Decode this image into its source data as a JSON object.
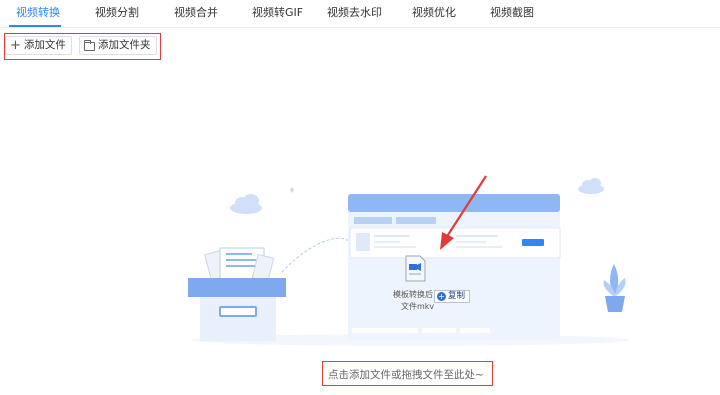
{
  "tabs": [
    {
      "label": "视频转换",
      "active": true
    },
    {
      "label": "视频分割",
      "active": false
    },
    {
      "label": "视频合并",
      "active": false
    },
    {
      "label": "视频转GIF",
      "active": false
    },
    {
      "label": "视频去水印",
      "active": false
    },
    {
      "label": "视频优化",
      "active": false
    },
    {
      "label": "视频截图",
      "active": false
    }
  ],
  "toolbar": {
    "add_file_label": "添加文件",
    "add_folder_label": "添加文件夹"
  },
  "dropzone": {
    "hint": "点击添加文件或拖拽文件至此处~",
    "dragged_file_name_line1": "模板转换后",
    "dragged_file_name_line2": "文件mkv",
    "copy_tooltip": "复制"
  },
  "colors": {
    "accent": "#2f86f6",
    "highlight_border": "#e23b3b",
    "illustration_blue": "#8fb6f5"
  },
  "icons": {
    "add": "plus-icon",
    "folder": "folder-icon",
    "file": "video-file-icon",
    "copy": "plus-circle-icon"
  }
}
